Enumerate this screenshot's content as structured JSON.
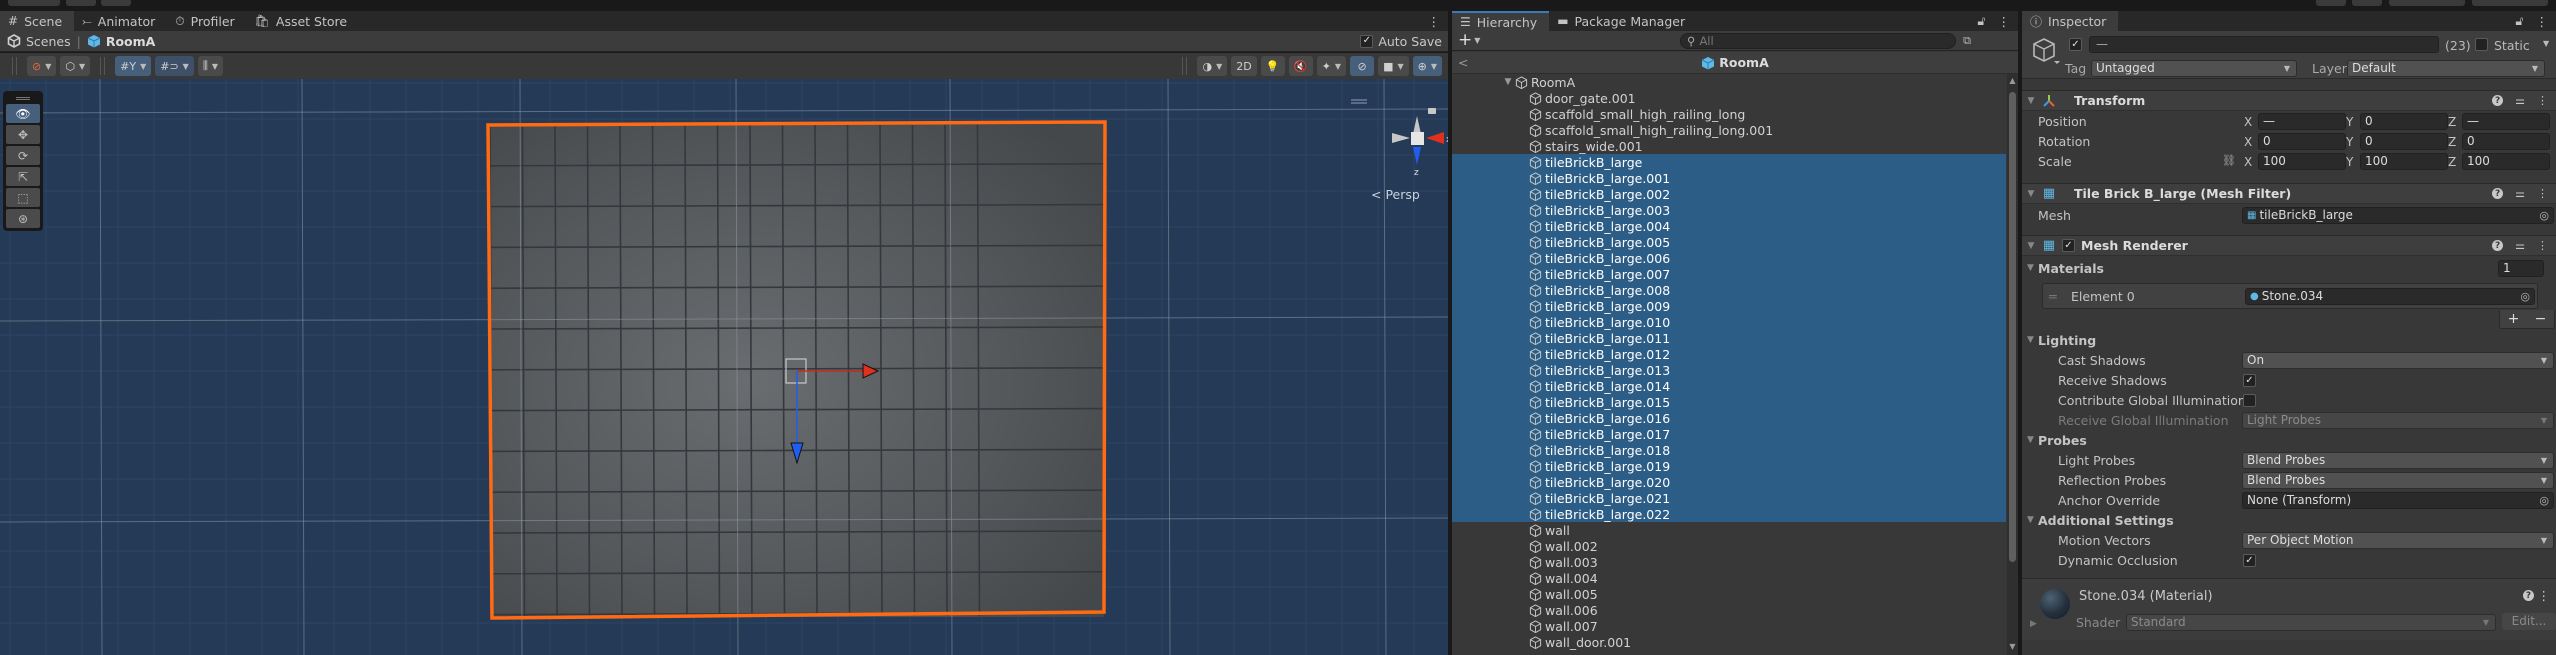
{
  "scene_panel": {
    "tabs": [
      {
        "label": "Scene",
        "icon": "grid-hash-icon",
        "active": true
      },
      {
        "label": "Animator",
        "icon": "animator-icon",
        "active": false
      },
      {
        "label": "Profiler",
        "icon": "stopwatch-icon",
        "active": false
      },
      {
        "label": "Asset Store",
        "icon": "shopping-bag-icon",
        "active": false
      }
    ],
    "breadcrumb": {
      "root": "Scenes",
      "current": "RoomA"
    },
    "auto_save": {
      "label": "Auto Save",
      "checked": true
    },
    "toolbar": {
      "two_d_label": "2D"
    },
    "tools": [
      "view",
      "move",
      "rotate",
      "scale",
      "rect",
      "transform"
    ],
    "active_tool": "view",
    "gizmo": {
      "x_label": "x",
      "z_label": "z",
      "projection_label": "< Persp"
    }
  },
  "hierarchy": {
    "tabs": [
      {
        "label": "Hierarchy",
        "icon": "list-icon",
        "active": true
      },
      {
        "label": "Package Manager",
        "icon": "package-icon",
        "active": false
      }
    ],
    "search_placeholder": "All",
    "scene_header": "RoomA",
    "items": [
      {
        "name": "RoomA",
        "depth": 0,
        "expanded": true,
        "selected": false
      },
      {
        "name": "door_gate.001",
        "depth": 1,
        "selected": false
      },
      {
        "name": "scaffold_small_high_railing_long",
        "depth": 1,
        "selected": false
      },
      {
        "name": "scaffold_small_high_railing_long.001",
        "depth": 1,
        "selected": false
      },
      {
        "name": "stairs_wide.001",
        "depth": 1,
        "selected": false
      },
      {
        "name": "tileBrickB_large",
        "depth": 1,
        "selected": true
      },
      {
        "name": "tileBrickB_large.001",
        "depth": 1,
        "selected": true
      },
      {
        "name": "tileBrickB_large.002",
        "depth": 1,
        "selected": true
      },
      {
        "name": "tileBrickB_large.003",
        "depth": 1,
        "selected": true
      },
      {
        "name": "tileBrickB_large.004",
        "depth": 1,
        "selected": true
      },
      {
        "name": "tileBrickB_large.005",
        "depth": 1,
        "selected": true
      },
      {
        "name": "tileBrickB_large.006",
        "depth": 1,
        "selected": true
      },
      {
        "name": "tileBrickB_large.007",
        "depth": 1,
        "selected": true
      },
      {
        "name": "tileBrickB_large.008",
        "depth": 1,
        "selected": true
      },
      {
        "name": "tileBrickB_large.009",
        "depth": 1,
        "selected": true
      },
      {
        "name": "tileBrickB_large.010",
        "depth": 1,
        "selected": true
      },
      {
        "name": "tileBrickB_large.011",
        "depth": 1,
        "selected": true
      },
      {
        "name": "tileBrickB_large.012",
        "depth": 1,
        "selected": true
      },
      {
        "name": "tileBrickB_large.013",
        "depth": 1,
        "selected": true
      },
      {
        "name": "tileBrickB_large.014",
        "depth": 1,
        "selected": true
      },
      {
        "name": "tileBrickB_large.015",
        "depth": 1,
        "selected": true
      },
      {
        "name": "tileBrickB_large.016",
        "depth": 1,
        "selected": true
      },
      {
        "name": "tileBrickB_large.017",
        "depth": 1,
        "selected": true
      },
      {
        "name": "tileBrickB_large.018",
        "depth": 1,
        "selected": true
      },
      {
        "name": "tileBrickB_large.019",
        "depth": 1,
        "selected": true
      },
      {
        "name": "tileBrickB_large.020",
        "depth": 1,
        "selected": true
      },
      {
        "name": "tileBrickB_large.021",
        "depth": 1,
        "selected": true
      },
      {
        "name": "tileBrickB_large.022",
        "depth": 1,
        "selected": true
      },
      {
        "name": "wall",
        "depth": 1,
        "selected": false
      },
      {
        "name": "wall.002",
        "depth": 1,
        "selected": false
      },
      {
        "name": "wall.003",
        "depth": 1,
        "selected": false
      },
      {
        "name": "wall.004",
        "depth": 1,
        "selected": false
      },
      {
        "name": "wall.005",
        "depth": 1,
        "selected": false
      },
      {
        "name": "wall.006",
        "depth": 1,
        "selected": false
      },
      {
        "name": "wall.007",
        "depth": 1,
        "selected": false
      },
      {
        "name": "wall_door.001",
        "depth": 1,
        "selected": false
      }
    ]
  },
  "inspector": {
    "tab_label": "Inspector",
    "object": {
      "active": true,
      "name": "—",
      "count": "(23)",
      "static_label": "Static",
      "static": false,
      "tag_label": "Tag",
      "tag": "Untagged",
      "layer_label": "Layer",
      "layer": "Default"
    },
    "transform": {
      "title": "Transform",
      "position_label": "Position",
      "rotation_label": "Rotation",
      "scale_label": "Scale",
      "position": {
        "x": "—",
        "y": "0",
        "z": "—"
      },
      "rotation": {
        "x": "0",
        "y": "0",
        "z": "0"
      },
      "scale": {
        "x": "100",
        "y": "100",
        "z": "100"
      }
    },
    "mesh_filter": {
      "title": "Tile Brick B_large (Mesh Filter)",
      "mesh_label": "Mesh",
      "mesh": "tileBrickB_large"
    },
    "mesh_renderer": {
      "title": "Mesh Renderer",
      "enabled": true,
      "materials_label": "Materials",
      "materials_count": "1",
      "element0_label": "Element 0",
      "element0_value": "Stone.034",
      "add_label": "+",
      "remove_label": "−",
      "lighting_label": "Lighting",
      "cast_shadows_label": "Cast Shadows",
      "cast_shadows": "On",
      "receive_shadows_label": "Receive Shadows",
      "receive_shadows": true,
      "contribute_gi_label": "Contribute Global Illumination",
      "contribute_gi": false,
      "receive_gi_label": "Receive Global Illumination",
      "receive_gi": "Light Probes",
      "probes_label": "Probes",
      "light_probes_label": "Light Probes",
      "light_probes": "Blend Probes",
      "reflection_probes_label": "Reflection Probes",
      "reflection_probes": "Blend Probes",
      "anchor_override_label": "Anchor Override",
      "anchor_override": "None (Transform)",
      "additional_label": "Additional Settings",
      "motion_vectors_label": "Motion Vectors",
      "motion_vectors": "Per Object Motion",
      "dynamic_occlusion_label": "Dynamic Occlusion",
      "dynamic_occlusion": true
    },
    "material": {
      "title": "Stone.034 (Material)",
      "shader_label": "Shader",
      "shader": "Standard",
      "edit_label": "Edit..."
    }
  },
  "colors": {
    "selection": "#2c5d87",
    "viewport_bg": "#243a56",
    "selection_outline": "#ff6a13",
    "gizmo_x": "#e0301e",
    "gizmo_z": "#1f5ef0",
    "active_tool": "#46607c"
  }
}
